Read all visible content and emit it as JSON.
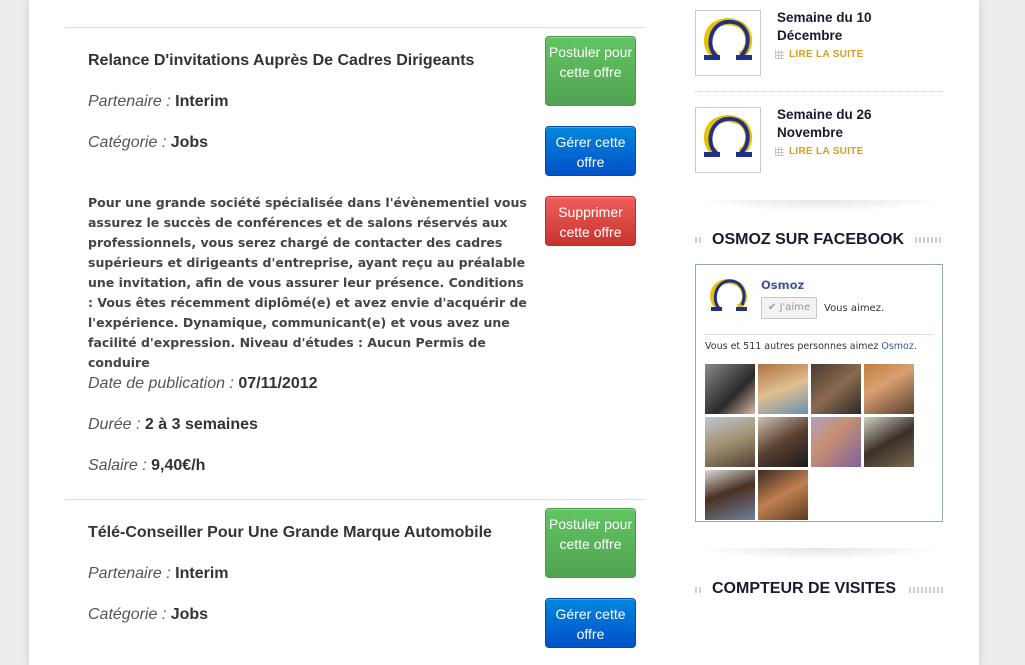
{
  "jobs": [
    {
      "title": "Relance D'invitations Auprès De Cadres Dirigeants",
      "partner_label": "Partenaire",
      "partner": "Interim",
      "category_label": "Catégorie",
      "category": "Jobs",
      "description": "Pour une grande société spécialisée dans l'évènementiel vous assurez le succès de conférences et de salons réservés aux professionnels, vous serez chargé de contacter des cadres supérieurs et dirigeants d'entreprise, ayant reçu au préalable une invitation, afin de vous assurer leur présence. Conditions : Vous êtes récemment diplômé(e) et avez envie d'acquérir de l'expérience. Dynamique, communicant(e) et vous avez une facilité d'expression. Niveau d'études : Aucun Permis de conduire",
      "date_label": "Date de publication",
      "date": "07/11/2012",
      "duration_label": "Durée",
      "duration": "2 à 3 semaines",
      "salary_label": "Salaire",
      "salary": "9,40€/h",
      "apply_label": "Postuler pour cette offre",
      "manage_label": "Gérer cette offre",
      "delete_label": "Supprimer cette offre"
    },
    {
      "title": "Télé-Conseiller Pour Une Grande Marque Automobile",
      "partner_label": "Partenaire",
      "partner": "Interim",
      "category_label": "Catégorie",
      "category": "Jobs",
      "apply_label": "Postuler pour cette offre",
      "manage_label": "Gérer cette offre"
    }
  ],
  "sidebar": {
    "posts": [
      {
        "title": "Semaine du 10 Décembre",
        "read_more": "LIRE LA SUITE"
      },
      {
        "title": "Semaine du 26 Novembre",
        "read_more": "LIRE LA SUITE"
      }
    ],
    "facebook_widget_title": "OSMOZ SUR FACEBOOK",
    "facebook": {
      "page_name": "Osmoz",
      "like_button": "J'aime",
      "you_like": "Vous aimez.",
      "count_prefix": "Vous et 511 autres personnes aimez ",
      "count_link": "Osmoz",
      "count_suffix": "."
    },
    "visits_widget_title": "COMPTEUR DE VISITES"
  },
  "colors": {
    "apply": "#5cb85c",
    "manage": "#0066dd",
    "delete": "#d9534f",
    "read_more": "#d4a020",
    "facebook_link": "#3b5998"
  }
}
